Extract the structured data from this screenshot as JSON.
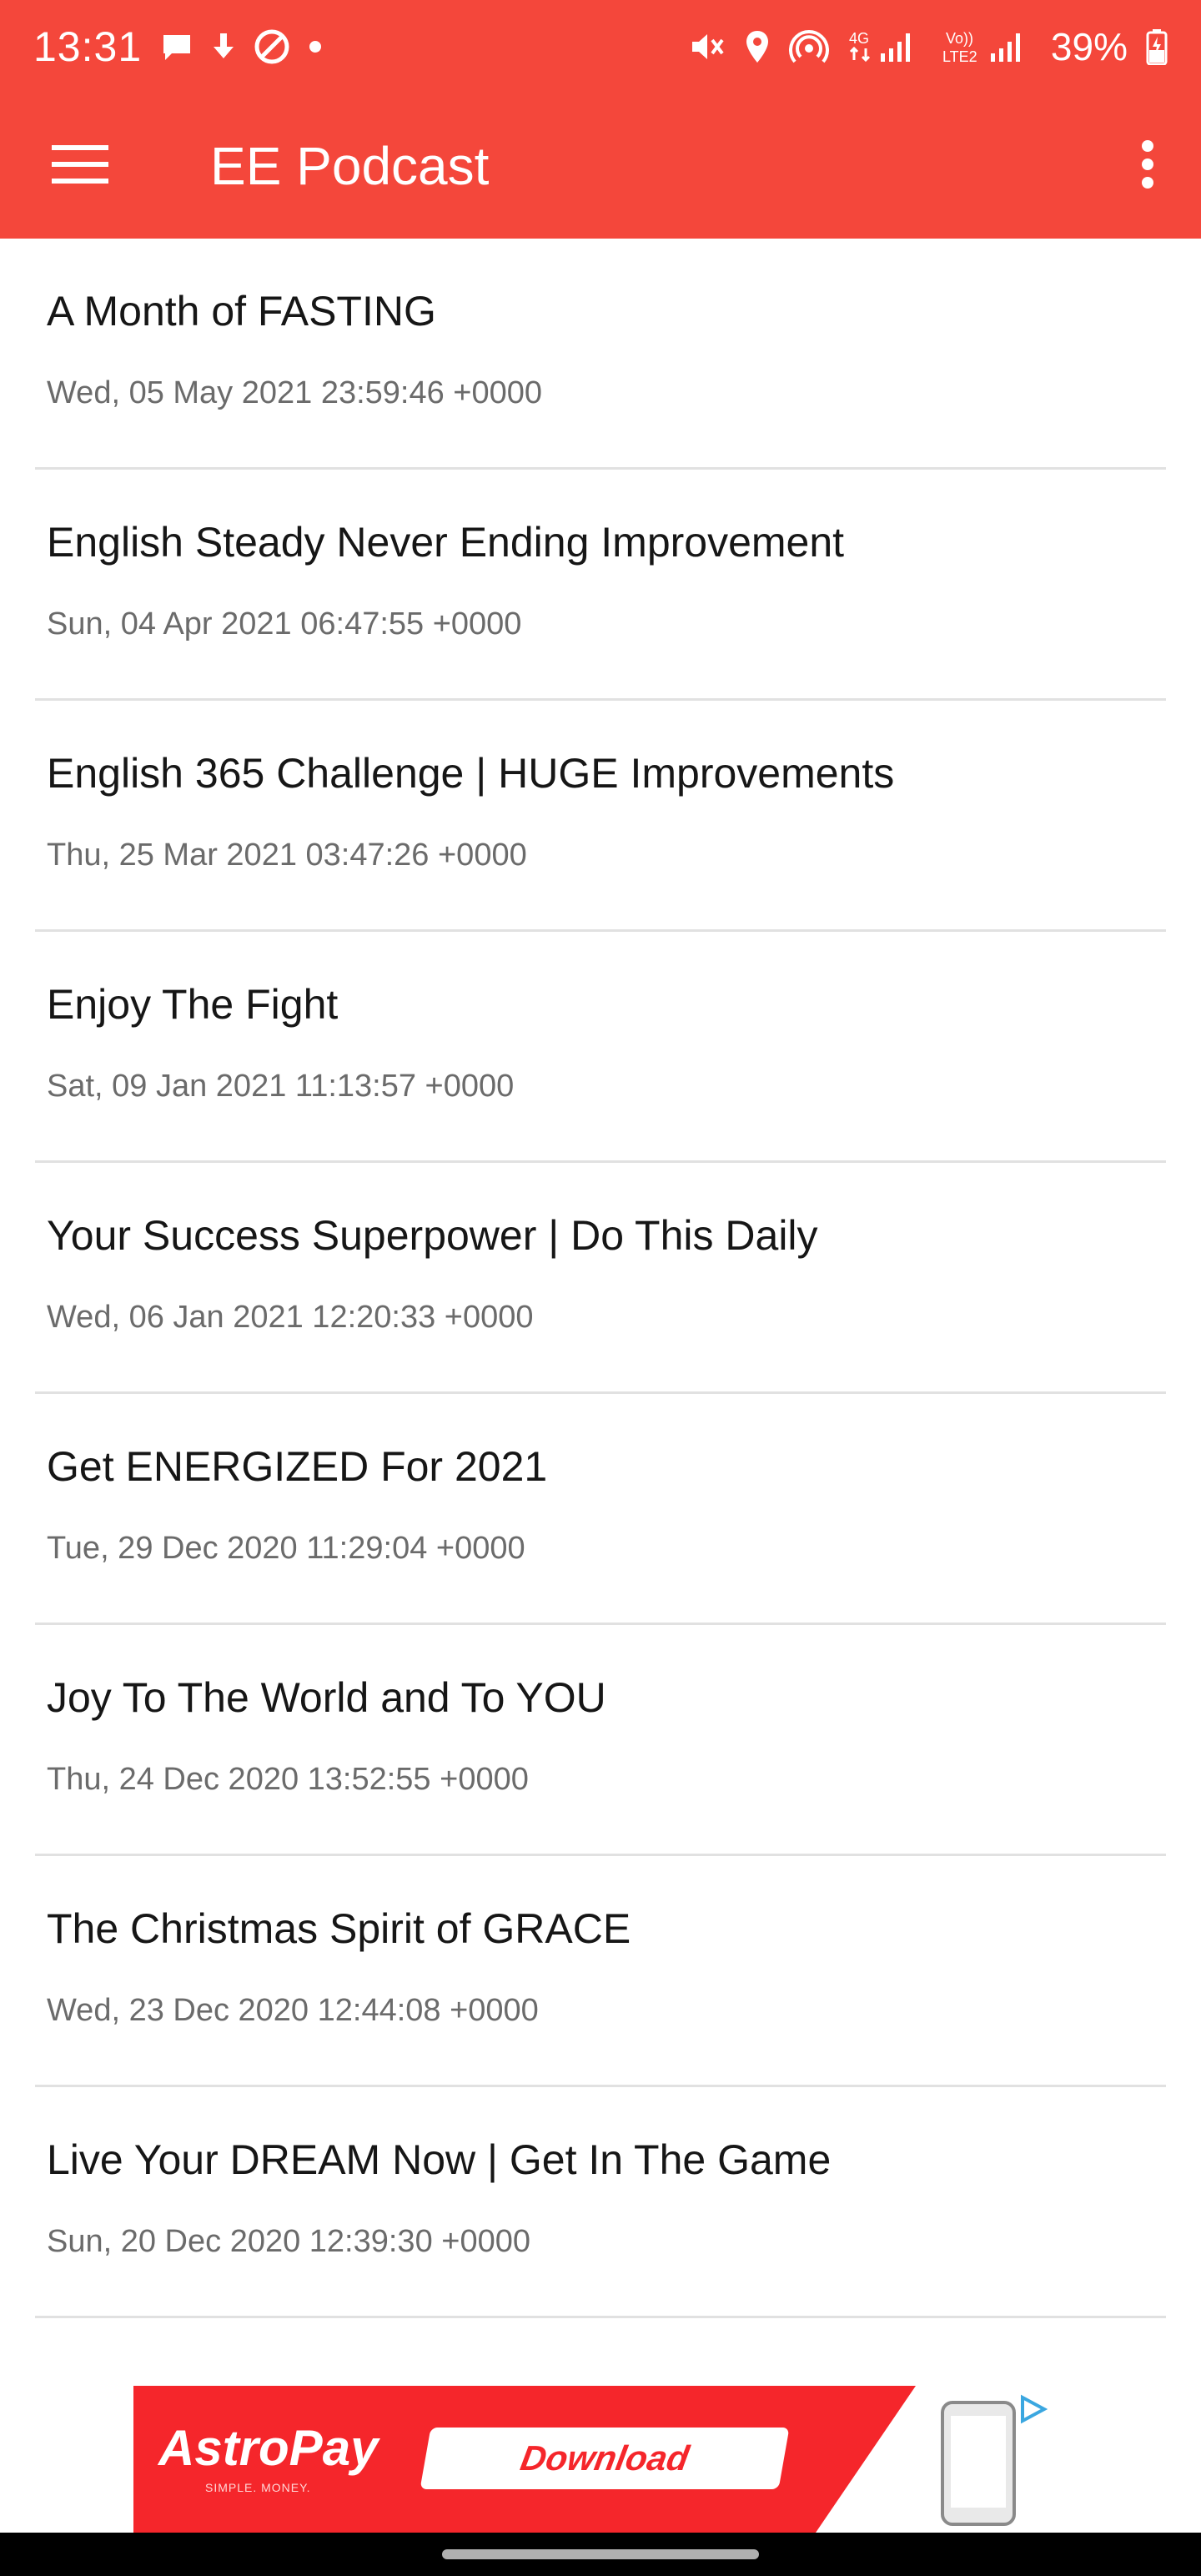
{
  "status_bar": {
    "time": "13:31",
    "battery": "39%",
    "network_4g": "4G",
    "network_volte": "Vo))",
    "network_lte2": "LTE2",
    "icons": [
      "chat-icon",
      "download-icon",
      "dnd-icon",
      "dot-icon",
      "mute-icon",
      "location-icon",
      "hotspot-icon",
      "signal-icon",
      "signal-icon",
      "battery-icon"
    ]
  },
  "app_bar": {
    "title": "EE Podcast",
    "background": "#f4473b"
  },
  "episodes": [
    {
      "title": "A Month of FASTING",
      "date": "Wed, 05 May 2021 23:59:46 +0000"
    },
    {
      "title": "English Steady Never Ending Improvement",
      "date": "Sun, 04 Apr 2021 06:47:55 +0000"
    },
    {
      "title": "English 365 Challenge | HUGE Improvements",
      "date": "Thu, 25 Mar 2021 03:47:26 +0000"
    },
    {
      "title": "Enjoy The Fight",
      "date": "Sat, 09 Jan 2021 11:13:57 +0000"
    },
    {
      "title": "Your Success Superpower | Do This Daily",
      "date": "Wed, 06 Jan 2021 12:20:33 +0000"
    },
    {
      "title": "Get ENERGIZED For 2021",
      "date": "Tue, 29 Dec 2020 11:29:04 +0000"
    },
    {
      "title": "Joy To The World and To YOU",
      "date": "Thu, 24 Dec 2020 13:52:55 +0000"
    },
    {
      "title": "The Christmas Spirit of GRACE",
      "date": "Wed, 23 Dec 2020 12:44:08 +0000"
    },
    {
      "title": "Live Your DREAM Now | Get In The Game",
      "date": "Sun, 20 Dec 2020 12:39:30 +0000"
    },
    {
      "title": "",
      "date": ""
    }
  ],
  "ad": {
    "brand": "AstroPay",
    "tagline": "SIMPLE. MONEY.",
    "cta": "Download",
    "color": "#f5262b"
  }
}
